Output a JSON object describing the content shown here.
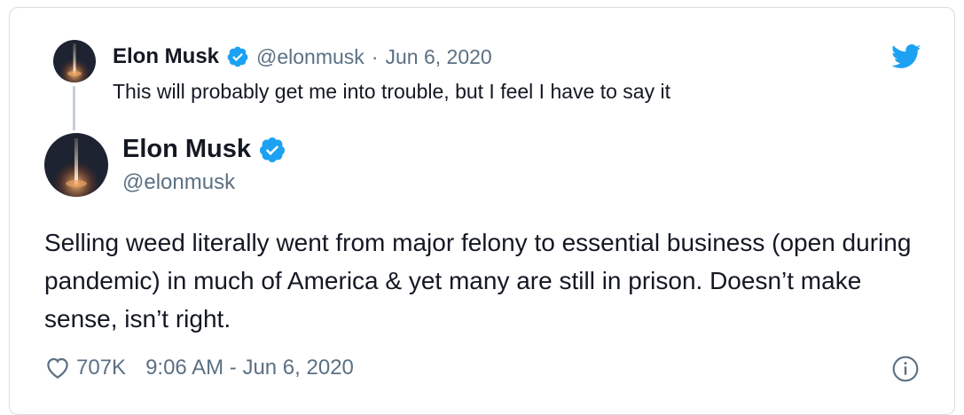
{
  "parent_tweet": {
    "author_name": "Elon Musk",
    "handle": "@elonmusk",
    "separator": "·",
    "date": "Jun 6, 2020",
    "text": "This will probably get me into trouble, but I feel I have to say it"
  },
  "main_tweet": {
    "author_name": "Elon Musk",
    "handle": "@elonmusk",
    "text": "Selling weed literally went from major felony to essential business (open during pandemic) in much of America & yet many are still in prison. Doesn’t make sense, isn’t right.",
    "like_count": "707K",
    "timestamp": "9:06 AM - Jun 6, 2020"
  },
  "icons": {
    "brand": "twitter-bird-icon",
    "verified": "verified-badge-icon",
    "like": "heart-icon",
    "info": "info-icon"
  },
  "colors": {
    "twitter_blue": "#1da1f2",
    "muted_text": "#5b7083",
    "border": "#d7dde3"
  }
}
